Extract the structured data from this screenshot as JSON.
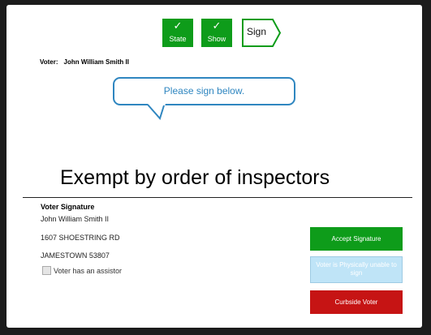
{
  "steps": [
    {
      "label": "State",
      "icon": "checkmark-icon",
      "color": "#0e9c1a"
    },
    {
      "label": "Show",
      "icon": "checkmark-icon",
      "color": "#0e9c1a"
    },
    {
      "label": "Sign",
      "color": "#0e9c1a"
    }
  ],
  "check_glyph": "✓",
  "voter": {
    "label": "Voter:",
    "name": "John William Smith II"
  },
  "prompt": "Please sign below.",
  "exempt_text": "Exempt by order of inspectors",
  "signature": {
    "title": "Voter Signature",
    "name": "John William Smith II",
    "address": "1607 SHOESTRING RD",
    "city": "JAMESTOWN 53807",
    "assistor_label": "Voter has an assistor",
    "assistor_checked": false
  },
  "buttons": {
    "accept": "Accept Signature",
    "unable": "Voter is Physically unable to sign",
    "curbside": "Curbside Voter"
  },
  "colors": {
    "accent_green": "#0e9c1a",
    "prompt_blue": "#2f86c0",
    "disabled_blue": "#bfe4f7",
    "curbside_red": "#c61414"
  }
}
